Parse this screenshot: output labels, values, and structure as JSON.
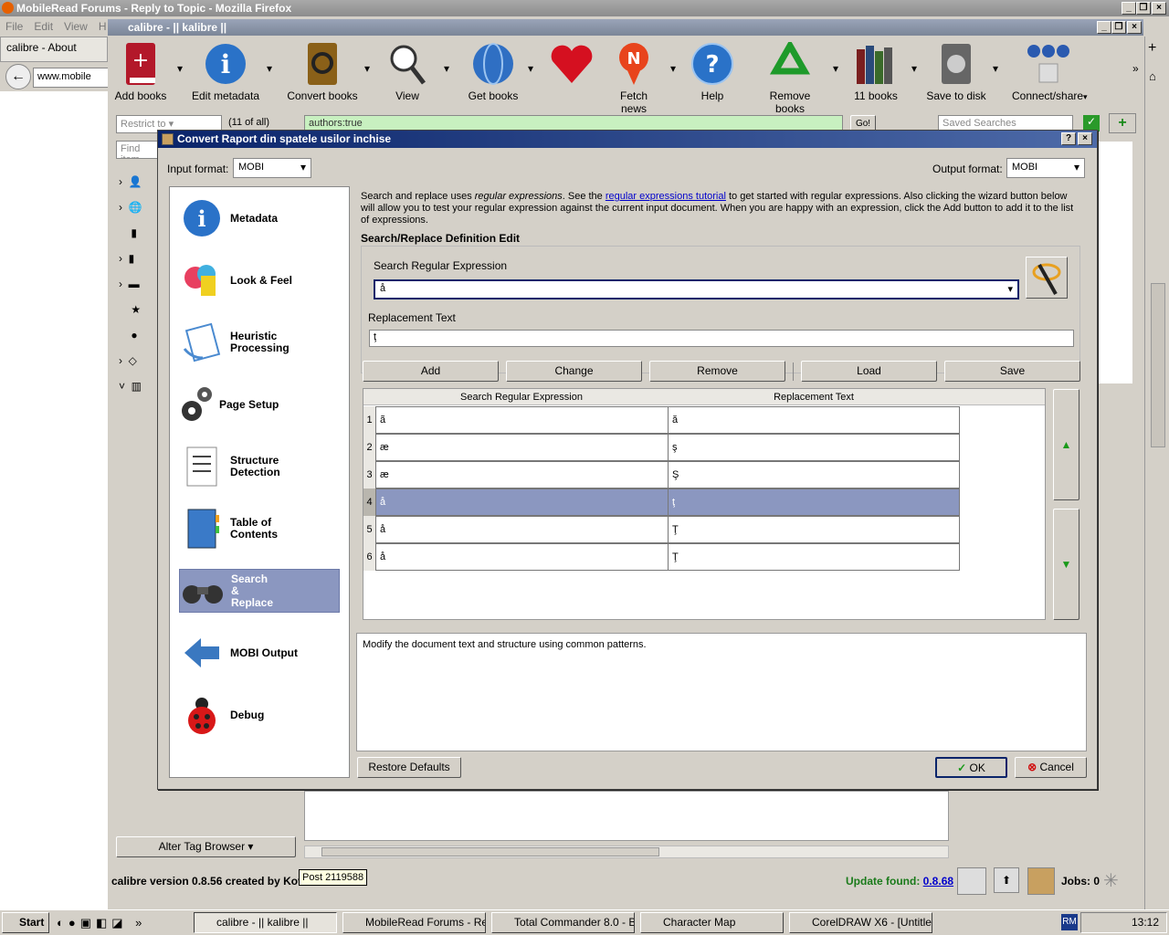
{
  "firefox": {
    "title": "MobileRead Forums - Reply to Topic - Mozilla Firefox",
    "menu": [
      "File",
      "Edit",
      "View",
      "H"
    ],
    "tab_label": "calibre - About",
    "url_text": "www.mobile"
  },
  "calibre": {
    "title": "calibre - || kalibre ||",
    "toolbar": [
      {
        "label": "Add books",
        "icon": "add-books-icon"
      },
      {
        "label": "Edit metadata",
        "icon": "info-icon"
      },
      {
        "label": "Convert books",
        "icon": "convert-icon"
      },
      {
        "label": "View",
        "icon": "magnifier-icon"
      },
      {
        "label": "Get books",
        "icon": "globe-icon"
      },
      {
        "label": "",
        "icon": "heart-icon"
      },
      {
        "label": "Fetch news",
        "icon": "news-icon"
      },
      {
        "label": "Help",
        "icon": "help-icon"
      },
      {
        "label": "Remove books",
        "icon": "recycle-icon"
      },
      {
        "label": "11 books",
        "icon": "library-icon"
      },
      {
        "label": "Save to disk",
        "icon": "disk-icon"
      },
      {
        "label": "Connect/share",
        "icon": "connect-icon"
      }
    ],
    "restrict_placeholder": "Restrict to",
    "count": "(11 of all)",
    "search_value": "authors:true",
    "go_label": "Go!",
    "saved_searches_placeholder": "Saved Searches",
    "find_item_placeholder": "Find item",
    "alter_tag_browser": "Alter Tag Browser",
    "version_text": "calibre version 0.8.56 created by Kov",
    "tooltip": "Post 2119588",
    "update_label": "Update found:",
    "update_version": "0.8.68",
    "jobs": "Jobs: 0"
  },
  "dialog": {
    "title": "Convert Raport din spatele usilor inchise",
    "help_btn": "?",
    "close_btn": "×",
    "input_format_label": "Input format:",
    "input_format_value": "MOBI",
    "output_format_label": "Output format:",
    "output_format_value": "MOBI",
    "sections": [
      {
        "label": "Metadata",
        "icon": "info-icon"
      },
      {
        "label": "Look & Feel",
        "icon": "paint-icon"
      },
      {
        "label": "Heuristic\nProcessing",
        "icon": "heuristic-icon"
      },
      {
        "label": "Page Setup",
        "icon": "gear-icon"
      },
      {
        "label": "Structure\nDetection",
        "icon": "document-icon"
      },
      {
        "label": "Table of\nContents",
        "icon": "notebook-icon"
      },
      {
        "label": "Search\n&\nReplace",
        "icon": "binoculars-icon"
      },
      {
        "label": "MOBI Output",
        "icon": "arrow-left-icon"
      },
      {
        "label": "Debug",
        "icon": "ladybug-icon"
      }
    ],
    "intro_part1": "Search and replace uses ",
    "intro_em": "regular expressions",
    "intro_part2": ". See the ",
    "intro_link": "regular expressions tutorial",
    "intro_part3": " to get started with regular expressions. Also clicking the wizard button below will allow you to test your regular expression against the current input document. When you are happy with an expression, click the Add button to add it to the list of expressions.",
    "section_title": "Search/Replace Definition Edit",
    "search_label": "Search Regular Expression",
    "search_value": " å",
    "replace_label": "Replacement Text",
    "replace_value": "ţ",
    "buttons": {
      "add": "Add",
      "change": "Change",
      "remove": "Remove",
      "load": "Load",
      "save": "Save"
    },
    "table_headers": [
      "Search Regular Expression",
      "Replacement Text"
    ],
    "rows": [
      {
        "num": "1",
        "search": "ã",
        "replace": "ă"
      },
      {
        "num": "2",
        "search": "æ",
        "replace": "ş"
      },
      {
        "num": "3",
        "search": "æ",
        "replace": "Ş"
      },
      {
        "num": "4",
        "search": "å",
        "replace": "ţ"
      },
      {
        "num": "5",
        "search": "å",
        "replace": "Ţ"
      },
      {
        "num": "6",
        "search": "å",
        "replace": "Ţ"
      }
    ],
    "description": "Modify the document text and structure using common patterns.",
    "restore_defaults": "Restore Defaults",
    "ok": "OK",
    "cancel": "Cancel"
  },
  "taskbar": {
    "start": "Start",
    "tasks": [
      "calibre - || kalibre ||",
      "MobileRead Forums - Re...",
      "Total Commander 8.0 - B...",
      "Character Map",
      "CorelDRAW X6 - [Untitle..."
    ],
    "lang": "RM",
    "clock": "13:12"
  },
  "colors": {
    "selection": "#8b97c0",
    "dialog_title": "#0a246a",
    "update_green": "#1a7a1a"
  }
}
